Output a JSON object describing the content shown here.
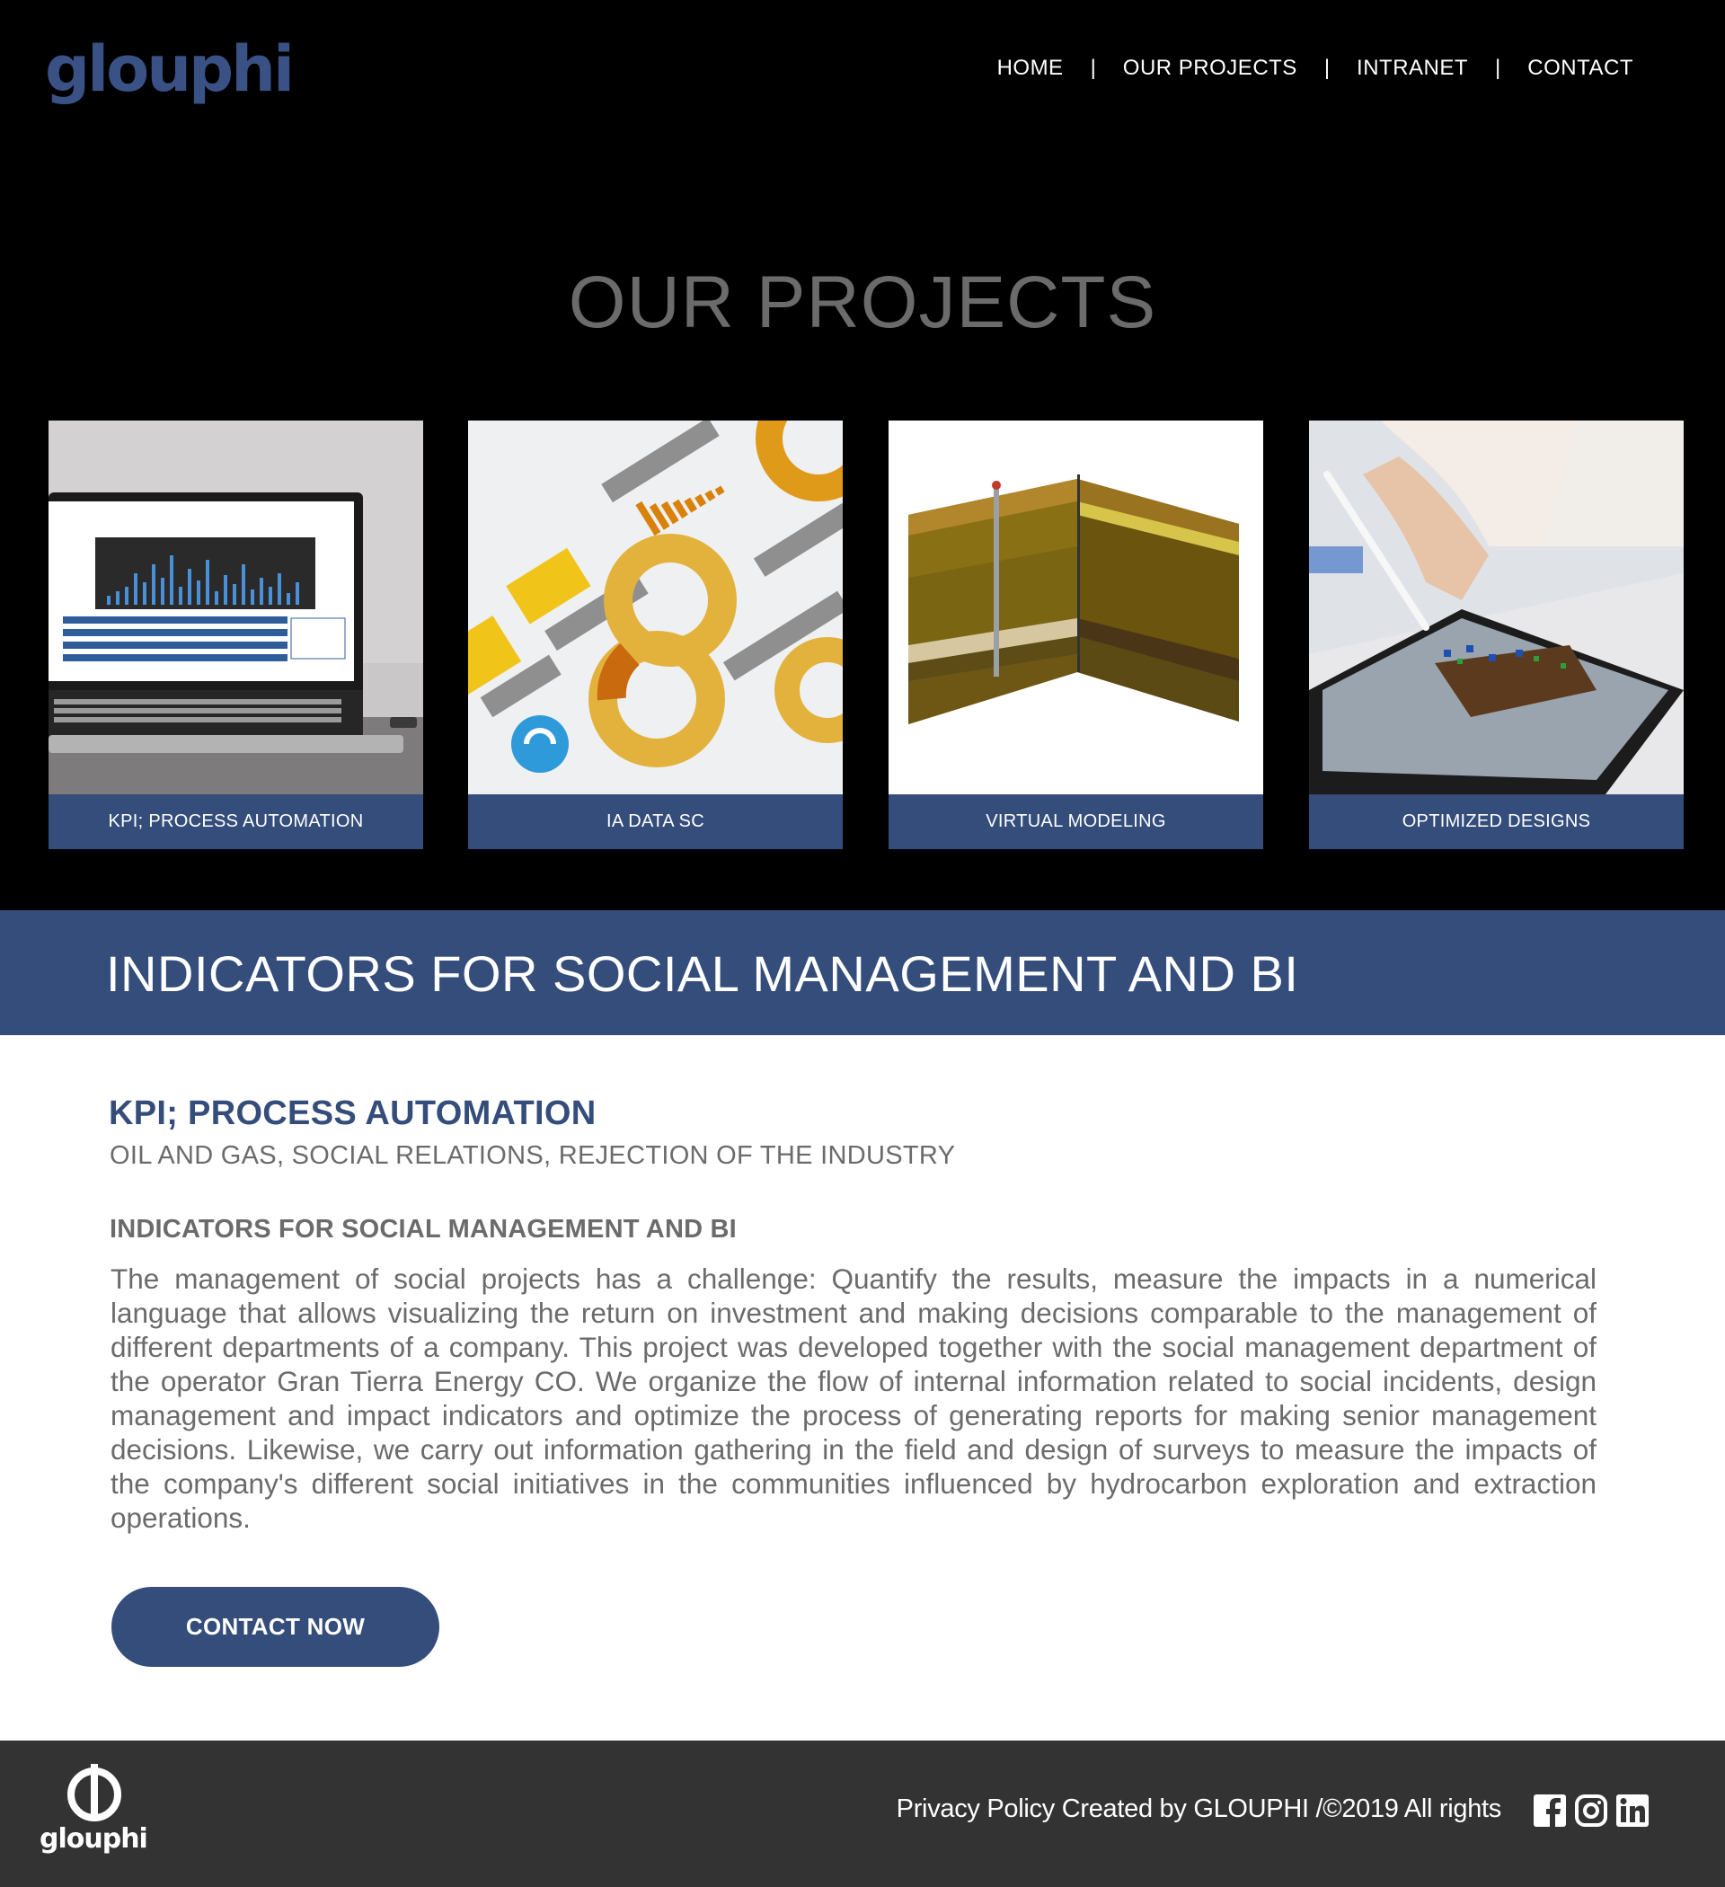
{
  "brand": {
    "logo_text": "glouphi",
    "color": "#3a5186",
    "accent": "#344d7a"
  },
  "nav": {
    "items": [
      "HOME",
      "OUR PROJECTS",
      "INTRANET",
      "CONTACT"
    ],
    "separator": "|"
  },
  "projects": {
    "title": "OUR PROJECTS",
    "cards": [
      {
        "label": "KPI; PROCESS AUTOMATION",
        "image": "laptop-dashboard"
      },
      {
        "label": "IA DATA SC",
        "image": "infographic-charts"
      },
      {
        "label": "VIRTUAL MODELING",
        "image": "geological-3d-model"
      },
      {
        "label": "OPTIMIZED DESIGNS",
        "image": "tablet-stylus-design"
      }
    ]
  },
  "banner": {
    "title": "INDICATORS FOR SOCIAL MANAGEMENT AND BI"
  },
  "detail": {
    "heading": "KPI; PROCESS AUTOMATION",
    "tags": "OIL AND GAS, SOCIAL RELATIONS, REJECTION OF THE INDUSTRY",
    "subheading": "INDICATORS FOR SOCIAL MANAGEMENT AND BI",
    "body": "The management of social projects has a challenge: Quantify the results, measure the impacts in a numerical language that allows visualizing the return on investment and making decisions comparable to the management of different departments of a company. This project was developed together with the social management department of the operator Gran Tierra Energy CO. We organize the flow of internal information related to social incidents, design management and impact indicators and optimize the process of generating reports for making senior management decisions. Likewise, we carry out information gathering in the field and design of surveys to measure the impacts of the company's different social initiatives in the communities influenced by hydrocarbon exploration and extraction operations.",
    "cta_label": "CONTACT NOW"
  },
  "footer": {
    "logo_text": "glouphi",
    "text": "Privacy Policy Created by GLOUPHI  /©2019 All rights",
    "social": [
      "facebook-icon",
      "instagram-icon",
      "linkedin-icon"
    ]
  }
}
